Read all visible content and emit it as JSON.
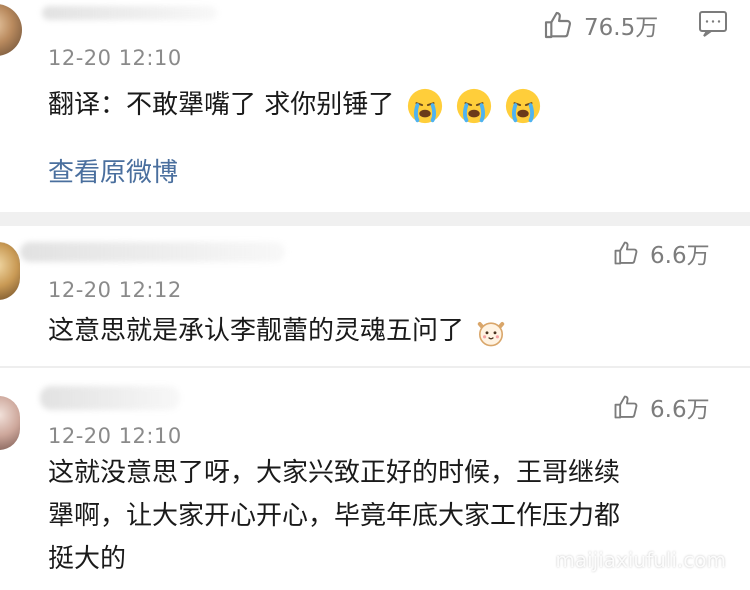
{
  "comments": [
    {
      "time": "12-20 12:10",
      "likes": "76.5万",
      "text": "翻译：不敢犟嘴了 求你别锤了",
      "emojis": [
        "crying-face-icon",
        "crying-face-icon",
        "crying-face-icon"
      ],
      "link_label": "查看原微博"
    },
    {
      "time": "12-20 12:12",
      "likes": "6.6万",
      "text": "这意思就是承认李靓蕾的灵魂五问了",
      "emojis": [
        "cat-face-icon"
      ]
    },
    {
      "time": "12-20 12:10",
      "likes": "6.6万",
      "lines": [
        "这就没意思了呀，大家兴致正好的时候，王哥继续",
        "犟啊，让大家开心开心，毕竟年底大家工作压力都",
        "挺大的"
      ]
    }
  ],
  "watermark": "maijiaxiufuli.com",
  "colors": {
    "link": "#4a6f9e",
    "meta": "#8a8a8a",
    "separator": "#f0f0f0"
  }
}
